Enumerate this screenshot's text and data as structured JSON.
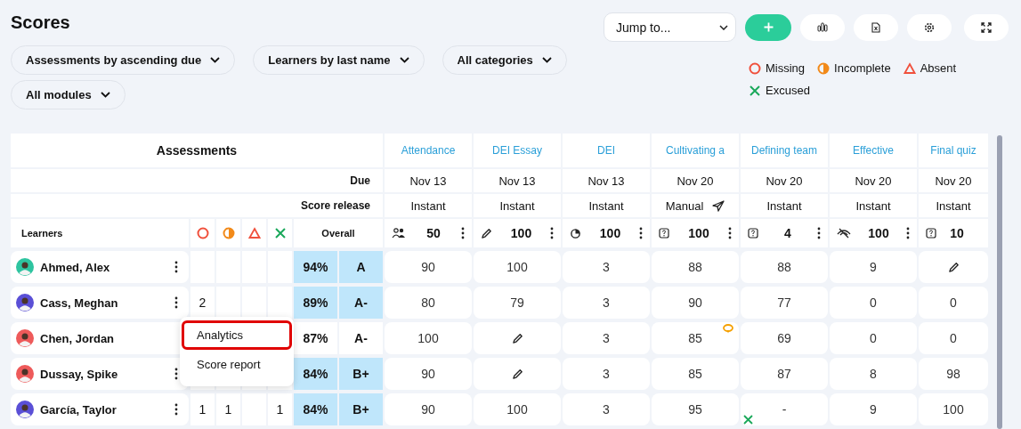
{
  "title": "Scores",
  "toolbar": {
    "jump": {
      "value": "Jump to..."
    },
    "buttons": [
      {
        "kind": "add"
      },
      {
        "kind": "chart"
      },
      {
        "kind": "excel"
      },
      {
        "kind": "settings"
      },
      {
        "kind": "expand"
      }
    ]
  },
  "filters": [
    {
      "label": "Assessments by ascending due"
    },
    {
      "label": "Learners by last name"
    },
    {
      "label": "All categories"
    },
    {
      "label": "All modules"
    }
  ],
  "legend": [
    {
      "kind": "missing",
      "label": "Missing"
    },
    {
      "kind": "incomplete",
      "label": "Incomplete"
    },
    {
      "kind": "absent",
      "label": "Absent"
    },
    {
      "kind": "excused",
      "label": "Excused"
    }
  ],
  "table": {
    "heading": "Assessments",
    "due_label": "Due",
    "release_label": "Score release",
    "learners_label": "Learners",
    "overall_label": "Overall",
    "status_columns": [
      {
        "kind": "missing"
      },
      {
        "kind": "incomplete"
      },
      {
        "kind": "absent"
      },
      {
        "kind": "excused"
      }
    ],
    "assessments": [
      {
        "title": "Attendance",
        "due": "Nov 13",
        "release": "Instant",
        "sent": false,
        "kind": "group",
        "points": "50",
        "menu": true
      },
      {
        "title": "DEI Essay",
        "due": "Nov 13",
        "release": "Instant",
        "sent": false,
        "kind": "pencil",
        "points": "100",
        "menu": true
      },
      {
        "title": "DEI",
        "due": "Nov 13",
        "release": "Instant",
        "sent": false,
        "kind": "pie",
        "points": "100",
        "menu": true
      },
      {
        "title": "Cultivating a",
        "due": "Nov 20",
        "release": "Manual",
        "sent": true,
        "kind": "quiz",
        "points": "100",
        "menu": true
      },
      {
        "title": "Defining team",
        "due": "Nov 20",
        "release": "Instant",
        "sent": false,
        "kind": "quiz",
        "points": "4",
        "menu": true
      },
      {
        "title": "Effective",
        "due": "Nov 20",
        "release": "Instant",
        "sent": false,
        "kind": "hidden",
        "points": "100",
        "menu": true
      },
      {
        "title": "Final quiz",
        "due": "Nov 20",
        "release": "Instant",
        "sent": false,
        "kind": "quiz",
        "points": "10",
        "menu": false
      }
    ],
    "rows": [
      {
        "name": "Ahmed, Alex",
        "color": "#2ec4a0",
        "percent": "94%",
        "grade": "A",
        "highlighted": true,
        "menu_open": false,
        "scores": [
          {
            "value": "90"
          },
          {
            "value": "100"
          },
          {
            "value": "3"
          },
          {
            "value": "88"
          },
          {
            "value": "88"
          },
          {
            "value": "9"
          },
          {
            "kind": "pencil"
          }
        ]
      },
      {
        "name": "Cass, Meghan",
        "color": "#5a4fd6",
        "missing": "2",
        "percent": "89%",
        "grade": "A-",
        "highlighted": true,
        "menu_open": false,
        "scores": [
          {
            "value": "80"
          },
          {
            "value": "79"
          },
          {
            "value": "3"
          },
          {
            "value": "90"
          },
          {
            "value": "77"
          },
          {
            "value": "0"
          },
          {
            "value": "0"
          }
        ]
      },
      {
        "name": "Chen, Jordan",
        "color": "#ee5a5a",
        "percent": "87%",
        "grade": "A-",
        "highlighted": false,
        "menu_open": true,
        "scores": [
          {
            "value": "100"
          },
          {
            "kind": "pencil"
          },
          {
            "value": "3"
          },
          {
            "value": "85",
            "comment": true
          },
          {
            "value": "69"
          },
          {
            "value": "0"
          },
          {
            "value": "0"
          }
        ]
      },
      {
        "name": "Dussay, Spike",
        "color": "#ee5a5a",
        "percent": "84%",
        "grade": "B+",
        "highlighted": true,
        "menu_open": false,
        "scores": [
          {
            "value": "90"
          },
          {
            "kind": "pencil"
          },
          {
            "value": "3"
          },
          {
            "value": "85"
          },
          {
            "value": "87"
          },
          {
            "value": "8"
          },
          {
            "value": "98"
          }
        ]
      },
      {
        "name": "García, Taylor",
        "color": "#5a4fd6",
        "missing": "1",
        "incomplete": "1",
        "excused": "1",
        "percent": "84%",
        "grade": "B+",
        "highlighted": true,
        "menu_open": false,
        "scores": [
          {
            "value": "90"
          },
          {
            "value": "100"
          },
          {
            "value": "3"
          },
          {
            "value": "95"
          },
          {
            "value": "-",
            "excused": true
          },
          {
            "value": "9"
          },
          {
            "value": "100"
          }
        ]
      }
    ]
  },
  "row_menu": {
    "items": [
      {
        "label": "Analytics",
        "highlighted": true
      },
      {
        "label": "Score report",
        "highlighted": false
      }
    ]
  }
}
